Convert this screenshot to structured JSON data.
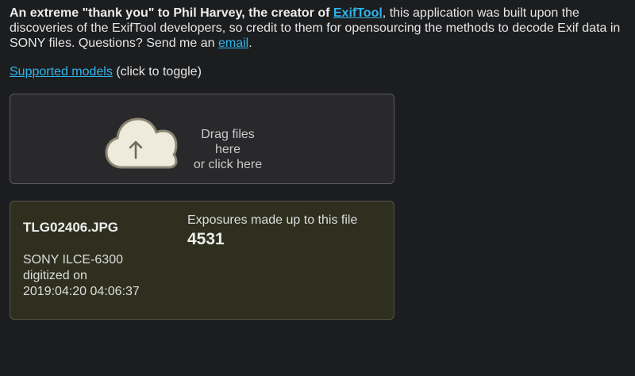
{
  "intro": {
    "bold_text": "An extreme \"thank you\" to Phil Harvey, the creator of",
    "exiftool_link": "ExifTool",
    "body_text": ", this application was built upon the discoveries of the ExifTool developers, so credit to them for opensourcing the methods to decode Exif data in SONY files. Questions? Send me an",
    "email_link": "email",
    "trailing": "."
  },
  "supported": {
    "link": "Supported models",
    "hint": "(click to toggle)"
  },
  "dropzone": {
    "line1": "Drag files here",
    "line2": "or click here",
    "icon": "cloud-upload-icon"
  },
  "result": {
    "filename": "TLG02406.JPG",
    "camera": "SONY ILCE-6300",
    "digitized_label": "digitized on",
    "digitized_date": "2019:04:20 04:06:37",
    "exposures_label": "Exposures made up to this file",
    "exposures_value": "4531"
  },
  "colors": {
    "background": "#1c1d1f",
    "link": "#30b4ec",
    "dropzone_bg": "#29292c",
    "result_bg": "#2f2f1f",
    "cloud_fill": "#eeeadc",
    "cloud_stroke": "#8a8473"
  }
}
